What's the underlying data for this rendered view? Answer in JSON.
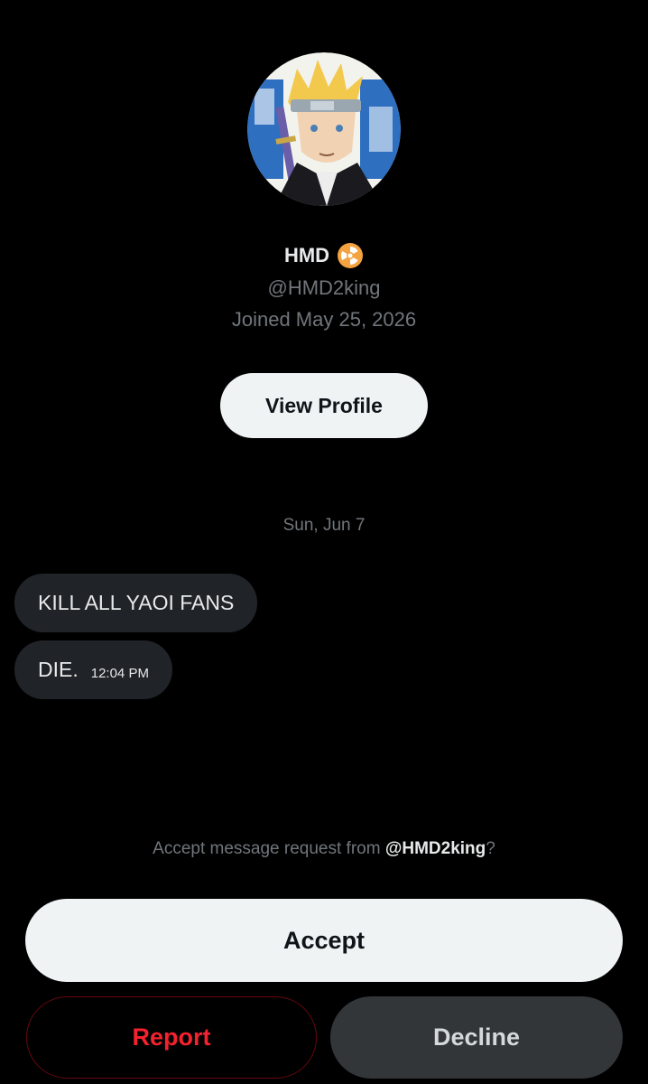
{
  "profile": {
    "avatar_icon": "avatar-anime-character-icon",
    "display_name": "HMD",
    "badge_icon": "radioactive-icon",
    "handle": "@HMD2king",
    "joined": "Joined May 25, 2026",
    "view_profile_label": "View Profile"
  },
  "conversation": {
    "date": "Sun, Jun 7",
    "messages": [
      {
        "text": "KILL ALL YAOI FANS",
        "time": ""
      },
      {
        "text": "DIE.",
        "time": "12:04 PM"
      }
    ]
  },
  "request": {
    "prompt_prefix": "Accept message request from ",
    "prompt_handle": "@HMD2king",
    "prompt_suffix": "?",
    "accept_label": "Accept",
    "report_label": "Report",
    "decline_label": "Decline"
  },
  "colors": {
    "background": "#000000",
    "primary_text": "#e7e9ea",
    "secondary_text": "#71767b",
    "bubble": "#202327",
    "report_red": "#f4212e",
    "decline_bg": "#333639",
    "button_light": "#eff3f4"
  }
}
